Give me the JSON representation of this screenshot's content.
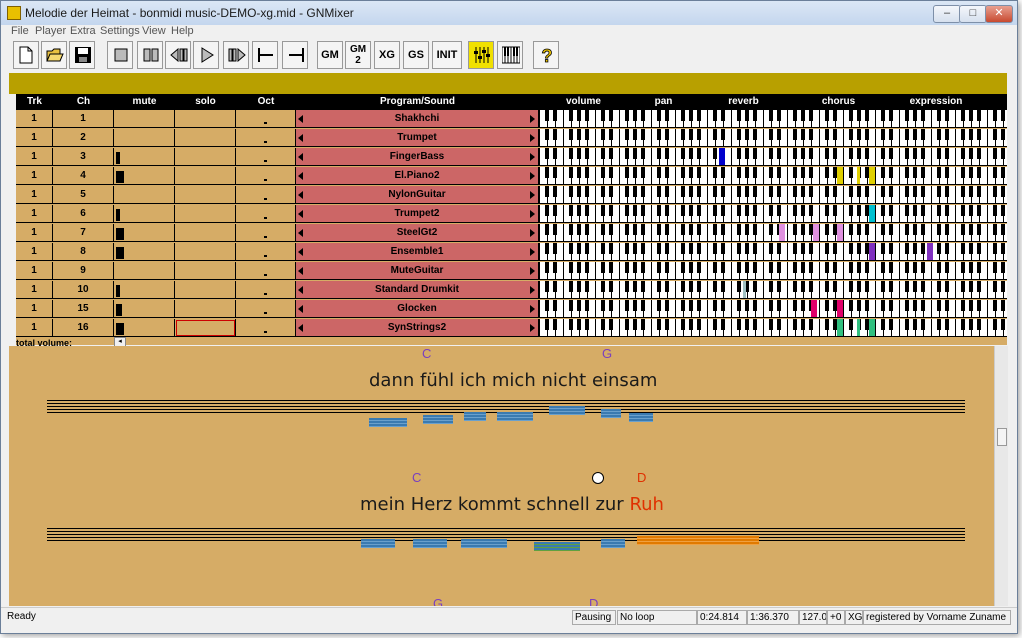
{
  "window": {
    "title": "Melodie der Heimat - bonmidi music-DEMO-xg.mid - GNMixer",
    "minimize": "‒",
    "maximize": "□",
    "close": "✕"
  },
  "menu": [
    "File",
    "Player",
    "Extra",
    "Settings",
    "View",
    "Help"
  ],
  "toolbar": {
    "gm": "GM",
    "gm2": "GM",
    "gm2_sub": "2",
    "xg": "XG",
    "gs": "GS",
    "init": "INIT"
  },
  "mixer": {
    "headers": {
      "trk": "Trk",
      "ch": "Ch",
      "mute": "mute",
      "solo": "solo",
      "oct": "Oct",
      "program": "Program/Sound",
      "volume": "volume",
      "pan": "pan",
      "reverb": "reverb",
      "chorus": "chorus",
      "expression": "expression"
    },
    "rows": [
      {
        "trk": "1",
        "ch": "1",
        "program": "Shakhchi",
        "mute": 0
      },
      {
        "trk": "1",
        "ch": "2",
        "program": "Trumpet",
        "mute": 0
      },
      {
        "trk": "1",
        "ch": "3",
        "program": "FingerBass",
        "mute": 0.3
      },
      {
        "trk": "1",
        "ch": "4",
        "program": "El.Piano2",
        "mute": 0.8
      },
      {
        "trk": "1",
        "ch": "5",
        "program": "NylonGuitar",
        "mute": 0
      },
      {
        "trk": "1",
        "ch": "6",
        "program": "Trumpet2",
        "mute": 0.3
      },
      {
        "trk": "1",
        "ch": "7",
        "program": "SteelGt2",
        "mute": 0.8
      },
      {
        "trk": "1",
        "ch": "8",
        "program": "Ensemble1",
        "mute": 0.8
      },
      {
        "trk": "1",
        "ch": "9",
        "program": "MuteGuitar",
        "mute": 0
      },
      {
        "trk": "1",
        "ch": "10",
        "program": "Standard Drumkit",
        "mute": 0.3
      },
      {
        "trk": "1",
        "ch": "15",
        "program": "Glocken",
        "mute": 0.5
      },
      {
        "trk": "1",
        "ch": "16",
        "program": "SynStrings2",
        "mute": 0.8
      }
    ],
    "total_volume_label": "total volume:",
    "total_slider": "◂"
  },
  "lyrics": {
    "line1": {
      "chord_a": "C",
      "chord_b": "G",
      "text": "dann fühl ich mich nicht einsam"
    },
    "line2": {
      "chord_a": "C",
      "chord_b": "D",
      "text": "mein Herz kommt schnell zur ",
      "highlight": "Ruh"
    },
    "line3": {
      "chord_a": "G",
      "chord_b": "D"
    }
  },
  "status": {
    "ready": "Ready",
    "state": "Pausing",
    "loop": "No loop",
    "position": "0:24.814",
    "length": "1:36.370",
    "tempo": "127.0",
    "transpose": "+0",
    "mode": "XG",
    "registered": "registered by Vorname Zuname"
  },
  "colors": {
    "panel": "#d6ac66",
    "program_bg": "#cc6666",
    "olive": "#b8a000",
    "accent_red": "#e03000",
    "chord": "#7a3fbf"
  }
}
